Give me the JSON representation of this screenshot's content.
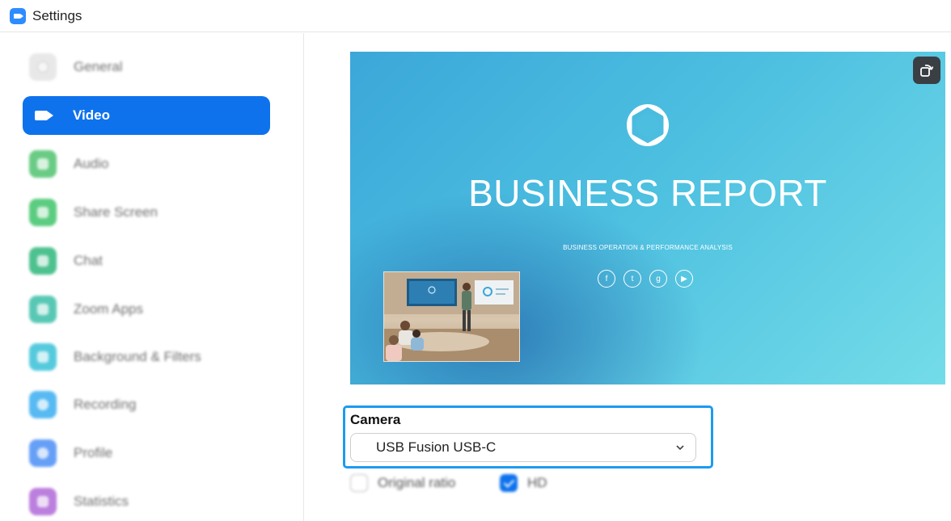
{
  "window": {
    "title": "Settings"
  },
  "sidebar": {
    "items": [
      {
        "label": "General",
        "icon": "general-icon",
        "color": "#d8d8d8",
        "active": false
      },
      {
        "label": "Video",
        "icon": "video-camera-icon",
        "color": "#ffffff",
        "active": true
      },
      {
        "label": "Audio",
        "icon": "headphones-icon",
        "color": "#4fc36f",
        "active": false
      },
      {
        "label": "Share Screen",
        "icon": "share-screen-icon",
        "color": "#3fc46a",
        "active": false
      },
      {
        "label": "Chat",
        "icon": "chat-icon",
        "color": "#2fb77c",
        "active": false
      },
      {
        "label": "Zoom Apps",
        "icon": "zoom-apps-icon",
        "color": "#3bbfa8",
        "active": false
      },
      {
        "label": "Background & Filters",
        "icon": "background-icon",
        "color": "#39c1d8",
        "active": false
      },
      {
        "label": "Recording",
        "icon": "recording-icon",
        "color": "#3aaef0",
        "active": false
      },
      {
        "label": "Profile",
        "icon": "profile-icon",
        "color": "#4b8ff5",
        "active": false
      },
      {
        "label": "Statistics",
        "icon": "statistics-icon",
        "color": "#b069d8",
        "active": false
      }
    ]
  },
  "preview": {
    "slide_title": "BUSINESS REPORT",
    "slide_subtitle": "BUSINESS OPERATION & PERFORMANCE ANALYSIS",
    "social_icons": [
      "f",
      "t",
      "g",
      "▶"
    ],
    "logo_text": "BUSINESS REPORT"
  },
  "camera": {
    "label": "Camera",
    "selected": "USB Fusion USB-C"
  },
  "options": {
    "original_ratio": {
      "label": "Original ratio",
      "checked": false
    },
    "hd": {
      "label": "HD",
      "checked": true
    }
  },
  "colors": {
    "accent": "#0e72ed",
    "focus_ring": "#1c9bf0"
  }
}
